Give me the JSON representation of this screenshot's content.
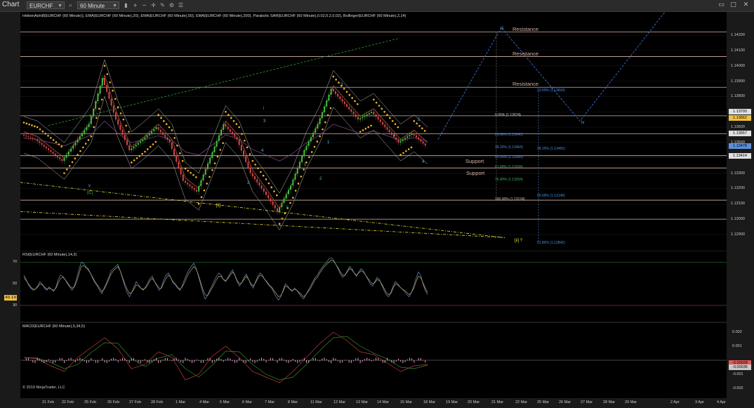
{
  "toolbar": {
    "title": "Chart",
    "instrument": "EURCHF",
    "interval": "60 Minute",
    "icons": [
      "search-icon",
      "bar-style-icon",
      "zoom-in-icon",
      "zoom-out-icon",
      "crosshair-icon",
      "draw-icon",
      "strategy-icon",
      "properties-icon"
    ],
    "window_icons": [
      "restore-icon",
      "maximize-icon",
      "close-icon"
    ]
  },
  "side_button": "F",
  "price_pane": {
    "title": "HeikenAshi8(EURCHF (60 Minute)), EMA(EURCHF (60 Minute),20), EMA(EURCHF (60 Minute),50), EMA(EURCHF (60 Minute),200), Parabolic SAR(EURCHF (60 Minute),0.02,0.2,0.02), Bollinger(EURCHF (60 Minute),2,14)",
    "ticks": [
      "1.14200",
      "1.14100",
      "1.14000",
      "1.13900",
      "1.13800",
      "1.13700",
      "1.13600",
      "1.13500",
      "1.13400",
      "1.13300",
      "1.13200",
      "1.13100",
      "1.13000",
      "1.12900"
    ],
    "price_tags": [
      {
        "label": "1.13700",
        "color": "#e0e0e0"
      },
      {
        "label": "1.13662",
        "color": "#f0c040"
      },
      {
        "label": "1.13557",
        "color": "#e0e0e0"
      },
      {
        "label": "1.13478",
        "color": "#5b8fd8"
      },
      {
        "label": "1.13414",
        "color": "#e0e0e0"
      }
    ],
    "levels": {
      "resistance": [
        "Resistance",
        "Resistance",
        "Resistance"
      ],
      "support": [
        "Support",
        "Support"
      ]
    },
    "fib_left": [
      "0.00% (1.13674)",
      "23.60% (1.13545)",
      "38.20% (1.13464)",
      "50.00% (1.13399)",
      "61.80% (1.13334)",
      "76.40% (1.13254)",
      "100.00% (1.13124)"
    ],
    "fib_right": [
      "23.60% (1.13834)",
      "38.20% (1.13455)",
      "50.00% (1.13148)",
      "61.80% (1.12842)"
    ],
    "wave_labels": [
      "iii",
      "iv",
      "[ii] ?",
      "v",
      "(C)",
      "[ii]",
      "ii",
      "i",
      "3",
      "4",
      "2",
      "1",
      "2",
      "1",
      "4",
      "3",
      "5",
      "4"
    ]
  },
  "rsi_pane": {
    "title": "RSI(EURCHF (60 Minute),14,3)",
    "ticks": [
      "70",
      "50",
      "30"
    ],
    "value_tag": "40.19",
    "series": [
      {
        "values": [
          58,
          54,
          49,
          46,
          44,
          45,
          48,
          52,
          50,
          46,
          44,
          47,
          45,
          43,
          47,
          54,
          58,
          57,
          54,
          50,
          47,
          44,
          48,
          55,
          63,
          70,
          69,
          66,
          64,
          60,
          55,
          51,
          48,
          44,
          41,
          46,
          51,
          56,
          62,
          64,
          66,
          68,
          62,
          55,
          48,
          42,
          38,
          42,
          47,
          52,
          49,
          46,
          44,
          47,
          51,
          55,
          57,
          52,
          48,
          44,
          47,
          54,
          58,
          60,
          56,
          51,
          49,
          46,
          44,
          48,
          54,
          59,
          63,
          66,
          69,
          65,
          58,
          50,
          42,
          36,
          39,
          44,
          48,
          53,
          57,
          60,
          58,
          54,
          52,
          56,
          60,
          63,
          58,
          52,
          48,
          51,
          56,
          59,
          54,
          49,
          46,
          52,
          57,
          60,
          58,
          54,
          51,
          48,
          46,
          42,
          38,
          35,
          38,
          44,
          50,
          48,
          45,
          43,
          46,
          44,
          41,
          38,
          36,
          40,
          44,
          48,
          52,
          56,
          58,
          62,
          65,
          68,
          70,
          73,
          74,
          72,
          68,
          64,
          59,
          56,
          58,
          62,
          66,
          64,
          60,
          57,
          61,
          64,
          62,
          58,
          54,
          50,
          48,
          52,
          56,
          54,
          49,
          44,
          40,
          38,
          42,
          48,
          52,
          50,
          47,
          45,
          43,
          40,
          38,
          42,
          48,
          55,
          61,
          58,
          50,
          44,
          40
        ],
        "color": "#6a8fc8"
      },
      {
        "values": [
          56,
          53,
          50,
          47,
          45,
          45,
          47,
          50,
          49,
          47,
          45,
          46,
          45,
          44,
          46,
          51,
          55,
          56,
          54,
          51,
          48,
          46,
          47,
          52,
          59,
          66,
          67,
          65,
          63,
          60,
          56,
          52,
          49,
          46,
          43,
          45,
          49,
          54,
          59,
          62,
          64,
          66,
          62,
          56,
          50,
          45,
          41,
          42,
          45,
          49,
          48,
          46,
          45,
          46,
          49,
          53,
          55,
          52,
          49,
          46,
          46,
          51,
          55,
          58,
          56,
          52,
          50,
          47,
          45,
          47,
          51,
          56,
          60,
          63,
          66,
          64,
          59,
          52,
          45,
          40,
          39,
          42,
          46,
          50,
          54,
          57,
          57,
          54,
          53,
          55,
          58,
          61,
          58,
          53,
          50,
          51,
          54,
          57,
          54,
          50,
          48,
          51,
          55,
          58,
          57,
          54,
          52,
          49,
          47,
          44,
          41,
          38,
          39,
          43,
          48,
          47,
          45,
          44,
          45,
          44,
          42,
          40,
          38,
          40,
          43,
          46,
          50,
          54,
          56,
          60,
          63,
          66,
          68,
          70,
          72,
          71,
          68,
          65,
          61,
          58,
          58,
          61,
          64,
          63,
          60,
          58,
          60,
          62,
          61,
          58,
          55,
          52,
          50,
          51,
          54,
          53,
          50,
          46,
          42,
          40,
          41,
          46,
          50,
          49,
          47,
          45,
          44,
          42,
          40,
          42,
          46,
          52,
          57,
          56,
          51,
          46,
          42
        ],
        "color": "#b5a86a"
      }
    ]
  },
  "macd_pane": {
    "title": "MACD(EURCHF (60 Minute),5,34,5)",
    "ticks": [
      "0.002",
      "0.001",
      "-0.001",
      "-0.002"
    ],
    "value_tags": [
      {
        "label": "-0.00028",
        "color": "#e05a5a"
      },
      {
        "label": "-0.00036",
        "color": "#c8c8c8"
      }
    ],
    "copyright": "© 2019 NinjaTrader, LLC"
  },
  "x_axis": [
    "21 Feb",
    "22 Feb",
    "25 Feb",
    "26 Feb",
    "27 Feb",
    "28 Feb",
    "1 Mar",
    "4 Mar",
    "5 Mar",
    "6 Mar",
    "7 Mar",
    "8 Mar",
    "11 Mar",
    "12 Mar",
    "13 Mar",
    "14 Mar",
    "15 Mar",
    "18 Mar",
    "19 Mar",
    "20 Mar",
    "21 Mar",
    "22 Mar",
    "25 Mar",
    "26 Mar",
    "27 Mar",
    "28 Mar",
    "29 Mar",
    "2 Apr",
    "3 Apr",
    "4 Apr"
  ],
  "colors": {
    "background": "#000000",
    "bull": "#3fbf3f",
    "bear": "#d04a4a",
    "sar": "#f0b429",
    "fib_blue": "#4a8fe0",
    "support_line": "#d7b3a6",
    "forecast": "#3a6fd8",
    "trendline": "#e8e230"
  }
}
